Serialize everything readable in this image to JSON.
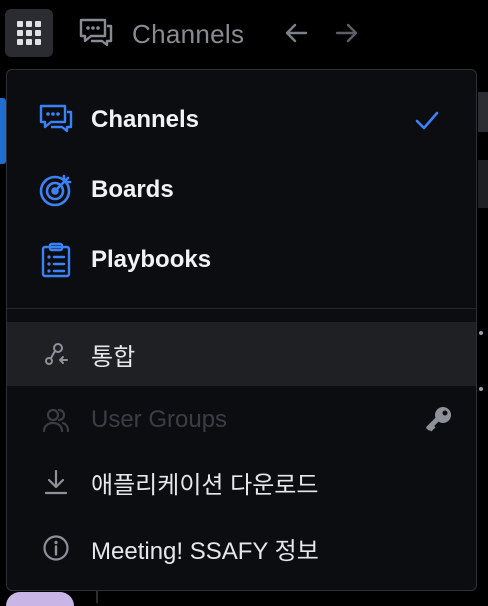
{
  "topbar": {
    "product_title": "Channels"
  },
  "menu": {
    "products": [
      {
        "label": "Channels",
        "selected": true
      },
      {
        "label": "Boards",
        "selected": false
      },
      {
        "label": "Playbooks",
        "selected": false
      }
    ],
    "items": [
      {
        "label": "통합",
        "icon": "integrations-icon",
        "state": "hover"
      },
      {
        "label": "User Groups",
        "icon": "user-groups-icon",
        "state": "disabled",
        "badge_icon": "key-icon"
      },
      {
        "label": "애플리케이션 다운로드",
        "icon": "download-icon",
        "state": "normal"
      },
      {
        "label": "Meeting! SSAFY 정보",
        "icon": "info-icon",
        "state": "normal"
      }
    ]
  },
  "colors": {
    "accent": "#3b82f6",
    "menu_bg": "#0c0d10",
    "hover_bg": "#1e2024"
  }
}
